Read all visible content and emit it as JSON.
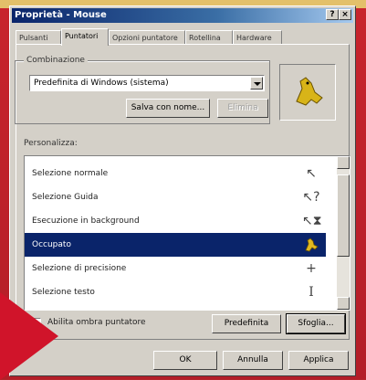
{
  "window": {
    "title": "Proprietà - Mouse",
    "help_btn": "?",
    "close_btn": "×"
  },
  "tabs": [
    {
      "label": "Pulsanti"
    },
    {
      "label": "Puntatori"
    },
    {
      "label": "Opzioni puntatore"
    },
    {
      "label": "Rotellina"
    },
    {
      "label": "Hardware"
    }
  ],
  "scheme": {
    "legend": "Combinazione",
    "selected": "Predefinita di Windows (sistema)",
    "save_as_label": "Salva con nome...",
    "delete_label": "Elimina"
  },
  "customize": {
    "label": "Personalizza:",
    "items": [
      {
        "label": "Selezione normale",
        "icon": "↖"
      },
      {
        "label": "Selezione Guida",
        "icon": "↖?"
      },
      {
        "label": "Esecuzione in background",
        "icon": "↖⧗"
      },
      {
        "label": "Occupato",
        "icon": "🐕"
      },
      {
        "label": "Selezione di precisione",
        "icon": "+"
      },
      {
        "label": "Selezione testo",
        "icon": "I"
      }
    ]
  },
  "shadow_label": "Abilita ombra puntatore",
  "buttons": {
    "default": "Predefinita",
    "browse": "Sfoglia...",
    "ok": "OK",
    "cancel": "Annulla",
    "apply": "Applica"
  }
}
